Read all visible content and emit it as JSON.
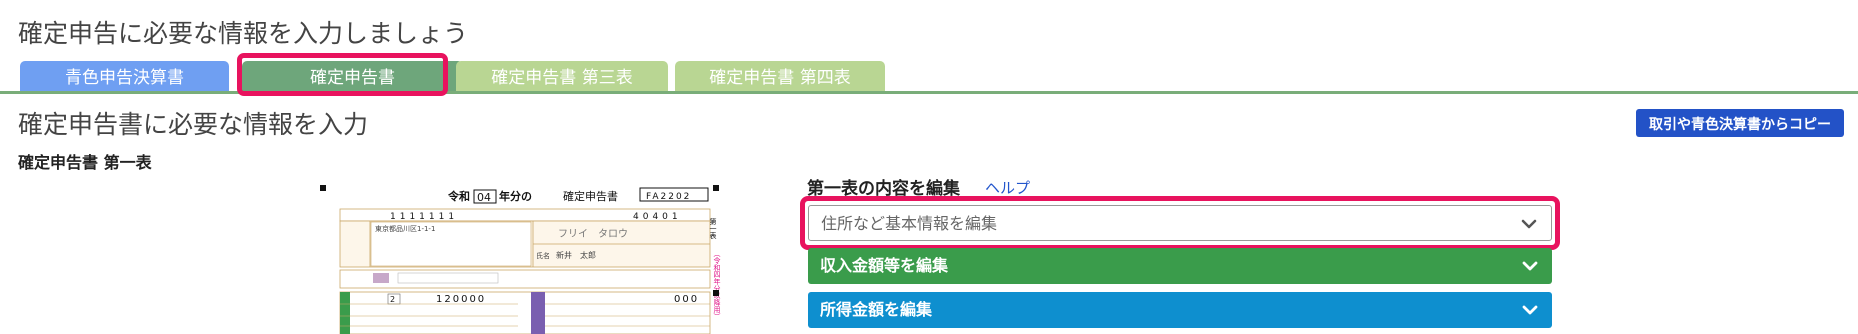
{
  "page_title": "確定申告に必要な情報を入力しましょう",
  "tabs": [
    {
      "label": "青色申告決算書",
      "color": "#6f9ff2",
      "active": false
    },
    {
      "label": "確定申告書",
      "color": "#6ea67b",
      "active": true
    },
    {
      "label": "確定申告書 第三表",
      "color": "#b9d693",
      "active": false
    },
    {
      "label": "確定申告書 第四表",
      "color": "#b9d693",
      "active": false
    }
  ],
  "section_title": "確定申告書に必要な情報を入力",
  "copy_button": "取引や青色決算書からコピー",
  "sub_title": "確定申告書 第一表",
  "form": {
    "year_prefix": "令和",
    "year": "04",
    "year_suffix": "年分の",
    "title": "確定申告書",
    "code": "FA2202",
    "address": "東京都品川区1-1-1",
    "furigana": "フリイ　タロウ",
    "name_label": "氏名",
    "name": "新井　太郎",
    "income_value": "120000",
    "right_value": "000",
    "side_label": "第一表",
    "side_right": "（令和四年分以降用）",
    "postal_digits": "1111111",
    "code_digits": "40401"
  },
  "edit": {
    "heading": "第一表の内容を編集",
    "help": "ヘルプ",
    "sections": [
      {
        "label": "住所など基本情報を編集",
        "style": "light"
      },
      {
        "label": "収入金額等を編集",
        "style": "green"
      },
      {
        "label": "所得金額を編集",
        "style": "blue"
      }
    ]
  },
  "colors": {
    "accent_highlight": "#e8135e",
    "button_blue": "#2352c7",
    "green": "#3a9c4b",
    "blue": "#0e8fcf"
  }
}
